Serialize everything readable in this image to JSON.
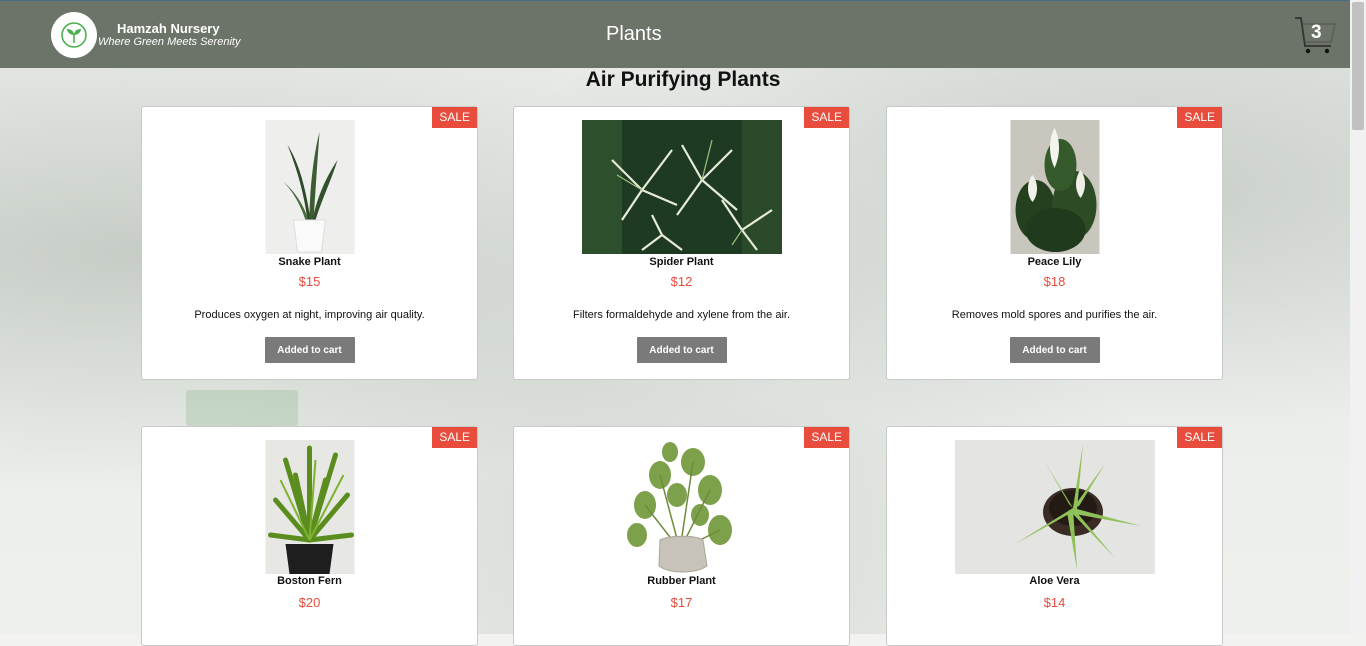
{
  "brand": {
    "name": "Hamzah Nursery",
    "tagline": "Where Green Meets Serenity"
  },
  "nav": {
    "title": "Plants"
  },
  "cart": {
    "count": "3"
  },
  "section": {
    "title": "Air Purifying Plants"
  },
  "products": [
    {
      "name": "Snake Plant",
      "price": "$15",
      "description": "Produces oxygen at night, improving air quality.",
      "badge": "SALE",
      "button": "Added to cart"
    },
    {
      "name": "Spider Plant",
      "price": "$12",
      "description": "Filters formaldehyde and xylene from the air.",
      "badge": "SALE",
      "button": "Added to cart"
    },
    {
      "name": "Peace Lily",
      "price": "$18",
      "description": "Removes mold spores and purifies the air.",
      "badge": "SALE",
      "button": "Added to cart"
    },
    {
      "name": "Boston Fern",
      "price": "$20",
      "description": "",
      "badge": "SALE",
      "button": ""
    },
    {
      "name": "Rubber Plant",
      "price": "$17",
      "description": "",
      "badge": "SALE",
      "button": ""
    },
    {
      "name": "Aloe Vera",
      "price": "$14",
      "description": "",
      "badge": "SALE",
      "button": ""
    }
  ],
  "colors": {
    "header": "#6c7369",
    "sale": "#e74c3c",
    "price": "#e74c3c",
    "button": "#7a7a7a"
  }
}
